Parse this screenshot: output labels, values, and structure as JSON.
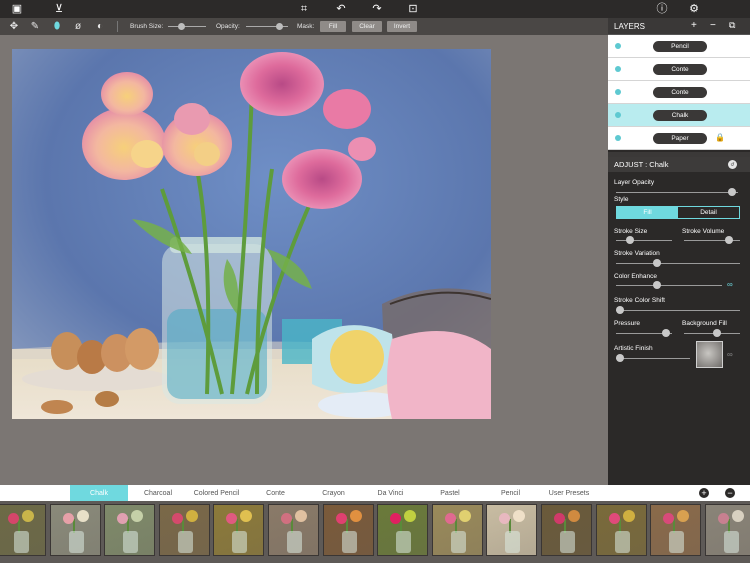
{
  "top_bar": {
    "icons": [
      "image-icon",
      "save-icon",
      "crop-icon",
      "undo-icon",
      "redo-icon",
      "fit-screen-icon",
      "info-icon",
      "settings-icon"
    ]
  },
  "toolbar": {
    "tools": [
      "move-icon",
      "brush-icon",
      "eraser-icon",
      "eyedropper-icon",
      "blend-icon"
    ],
    "brush_size_label": "Brush Size:",
    "brush_size_value": 0.32,
    "opacity_label": "Opacity:",
    "opacity_value": 0.85,
    "mask_label": "Mask:",
    "fill_label": "Fill",
    "clear_label": "Clear",
    "invert_label": "Invert"
  },
  "layers": {
    "title": "LAYERS",
    "actions": [
      "+",
      "−",
      "⧉"
    ],
    "items": [
      {
        "label": "Pencil",
        "selected": false,
        "locked": false
      },
      {
        "label": "Conte",
        "selected": false,
        "locked": false
      },
      {
        "label": "Conte",
        "selected": false,
        "locked": false
      },
      {
        "label": "Chalk",
        "selected": true,
        "locked": false
      },
      {
        "label": "Paper",
        "selected": false,
        "locked": true
      }
    ]
  },
  "adjust": {
    "title": "ADJUST : Chalk",
    "reset_label": "",
    "layer_opacity": {
      "label": "Layer Opacity",
      "value": 0.98
    },
    "style": {
      "label": "Style",
      "options": [
        "Fill",
        "Detail"
      ],
      "selected": "Fill"
    },
    "stroke_size": {
      "label": "Stroke Size",
      "value": 0.2
    },
    "stroke_volume": {
      "label": "Stroke Volume",
      "value": 0.85
    },
    "stroke_variation": {
      "label": "Stroke Variation",
      "value": 0.32
    },
    "color_enhance": {
      "label": "Color Enhance",
      "value": 0.38
    },
    "stroke_color_shift": {
      "label": "Stroke Color Shift",
      "value": 0.0
    },
    "pressure": {
      "label": "Pressure",
      "value": 0.95
    },
    "background_fill": {
      "label": "Background Fill",
      "value": 0.6
    },
    "artistic_finish": {
      "label": "Artistic Finish",
      "value": 0.0
    }
  },
  "preset_tabs": {
    "items": [
      "Chalk",
      "Charcoal",
      "Colored Pencil",
      "Conte",
      "Crayon",
      "Da Vinci",
      "Pastel",
      "Pencil",
      "User Presets"
    ],
    "selected": "Chalk",
    "add_label": "+",
    "remove_label": "−"
  },
  "thumbnails": [
    {
      "bg": "#6d6a46",
      "f1": "#d4466a",
      "f2": "#c9b54a"
    },
    {
      "bg": "#8a8a7a",
      "f1": "#e6a0a8",
      "f2": "#e8e0c8"
    },
    {
      "bg": "#7f8a6a",
      "f1": "#e0a0b0",
      "f2": "#c5d0a8"
    },
    {
      "bg": "#7a6848",
      "f1": "#d44a6c",
      "f2": "#d0b040"
    },
    {
      "bg": "#8c7a3a",
      "f1": "#e05a80",
      "f2": "#e0c050"
    },
    {
      "bg": "#8a7a68",
      "f1": "#d07080",
      "f2": "#e0c0a0"
    },
    {
      "bg": "#7a5a3a",
      "f1": "#e04070",
      "f2": "#e09040"
    },
    {
      "bg": "#6a7a3a",
      "f1": "#e02060",
      "f2": "#c0d040"
    },
    {
      "bg": "#9a8a5a",
      "f1": "#e06a90",
      "f2": "#e0d070"
    },
    {
      "bg": "#c8bca2",
      "f1": "#e8b8c0",
      "f2": "#efe0c8"
    },
    {
      "bg": "#6a5a3a",
      "f1": "#d03a6a",
      "f2": "#d08a40"
    },
    {
      "bg": "#7a6a3a",
      "f1": "#e04a7a",
      "f2": "#d0b040"
    },
    {
      "bg": "#8a6a4a",
      "f1": "#d84a7a",
      "f2": "#d8a050"
    },
    {
      "bg": "#8a8478",
      "f1": "#c88090",
      "f2": "#d8d0c0"
    }
  ]
}
